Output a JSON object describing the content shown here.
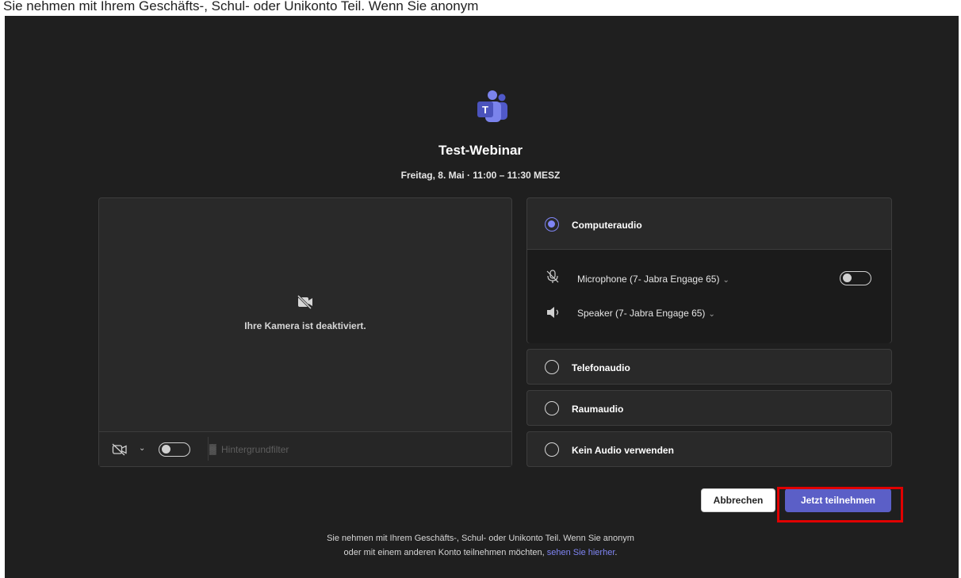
{
  "top_caption": "Sie nehmen mit Ihrem Geschäfts-, Schul- oder Unikonto Teil. Wenn Sie anonym",
  "meeting": {
    "title": "Test-Webinar",
    "schedule": "Freitag, 8. Mai  ·  11:00  –  11:30 MESZ"
  },
  "video": {
    "camera_off_text": "Ihre Kamera ist deaktiviert.",
    "background_filter_label": "Hintergrundfilter",
    "camera_toggle_on": false
  },
  "audio": {
    "options": [
      {
        "label": "Computeraudio",
        "selected": true
      },
      {
        "label": "Telefonaudio",
        "selected": false
      },
      {
        "label": "Raumaudio",
        "selected": false
      },
      {
        "label": "Kein Audio verwenden",
        "selected": false
      }
    ],
    "microphone_label": "Microphone (7- Jabra Engage 65)",
    "speaker_label": "Speaker (7- Jabra Engage 65)",
    "mic_toggle_on": false
  },
  "buttons": {
    "cancel": "Abbrechen",
    "join": "Jetzt teilnehmen"
  },
  "footer": {
    "line1": "Sie nehmen mit Ihrem Geschäfts-, Schul- oder Unikonto Teil. Wenn Sie anonym",
    "line2_prefix": "oder mit einem anderen Konto teilnehmen möchten, ",
    "link": "sehen Sie hierher",
    "line2_suffix": "."
  },
  "colors": {
    "background": "#1f1f1f",
    "accent": "#5b5fc7",
    "link": "#7f85f5",
    "highlight": "#e00000"
  }
}
